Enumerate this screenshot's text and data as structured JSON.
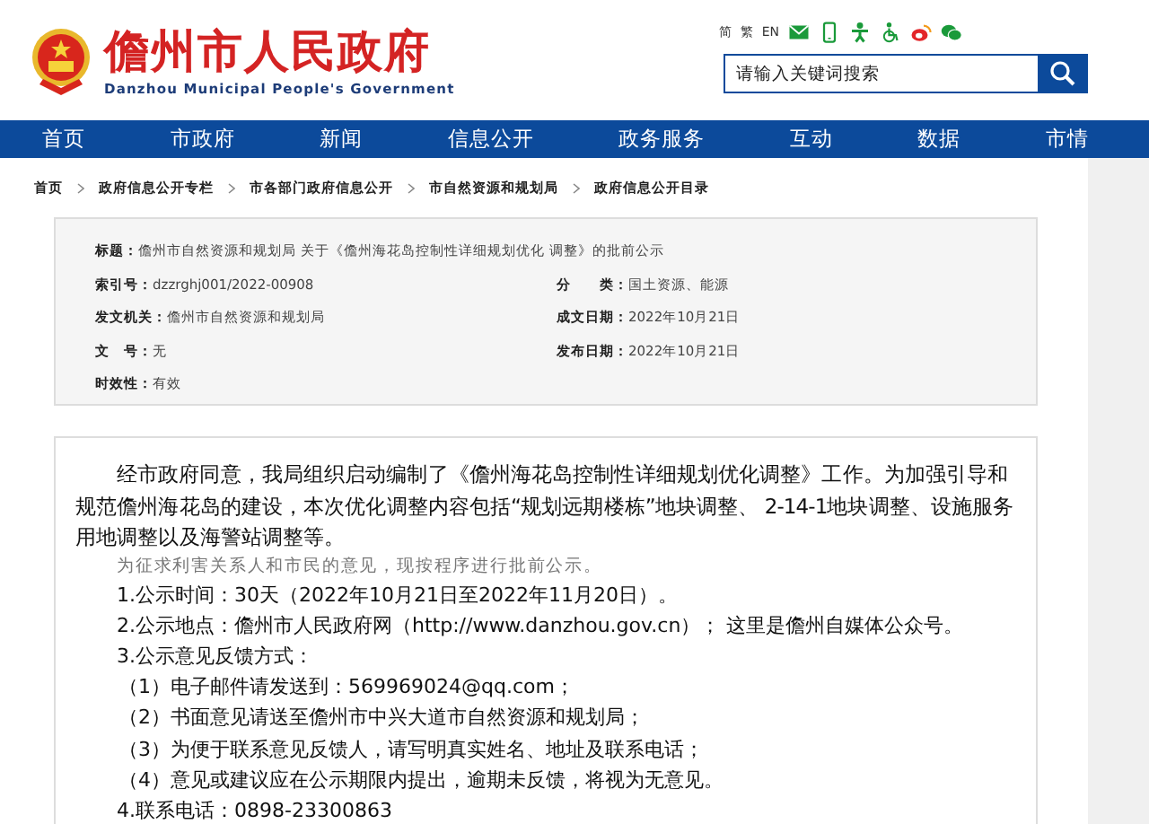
{
  "header": {
    "site_title": "儋州市人民政府",
    "site_subtitle": "Danzhou Municipal People's Government",
    "language_links": [
      "简",
      "繁",
      "EN"
    ],
    "search": {
      "placeholder": "请输入关键词搜索"
    }
  },
  "nav": [
    "首页",
    "市政府",
    "新闻",
    "信息公开",
    "政务服务",
    "互动",
    "数据",
    "市情"
  ],
  "breadcrumb": [
    "首页",
    "政府信息公开专栏",
    "市各部门政府信息公开",
    "市自然资源和规划局",
    "政府信息公开目录"
  ],
  "info": {
    "title": {
      "label": "标题：",
      "value": "儋州市自然资源和规划局 关于《儋州海花岛控制性详细规划优化 调整》的批前公示"
    },
    "rows": [
      [
        {
          "label": "索引号：",
          "value": "dzzrghj001/2022-00908"
        },
        {
          "label": "分　　类：",
          "value": "国土资源、能源"
        }
      ],
      [
        {
          "label": "发文机关：",
          "value": "儋州市自然资源和规划局"
        },
        {
          "label": "成文日期：",
          "value": "2022年10月21日"
        }
      ],
      [
        {
          "label": "文　号：",
          "value": "无"
        },
        {
          "label": "发布日期：",
          "value": "2022年10月21日"
        }
      ],
      [
        {
          "label": "时效性：",
          "value": "有效"
        }
      ]
    ]
  },
  "body": [
    {
      "kind": "para",
      "text": "经市政府同意，我局组织启动编制了《儋州海花岛控制性详细规划优化调整》工作。为加强引导和规范儋州海花岛的建设，本次优化调整内容包括“规划远期楼栋”地块调整、 2-14-1地块调整、设施服务用地调整以及海警站调整等。"
    },
    {
      "kind": "note",
      "text": "为征求利害关系人和市民的意见，现按程序进行批前公示。"
    },
    {
      "kind": "item",
      "text": "1.公示时间：30天（2022年10月21日至2022年11月20日）。"
    },
    {
      "kind": "item",
      "text": "2.公示地点：儋州市人民政府网（http://www.danzhou.gov.cn）； 这里是儋州自媒体公众号。"
    },
    {
      "kind": "item",
      "text": "3.公示意见反馈方式："
    },
    {
      "kind": "subitem",
      "text": "（1）电子邮件请发送到：569969024@qq.com；"
    },
    {
      "kind": "subitem",
      "text": "（2）书面意见请送至儋州市中兴大道市自然资源和规划局；"
    },
    {
      "kind": "subitem",
      "text": "（3）为便于联系意见反馈人，请写明真实姓名、地址及联系电话；"
    },
    {
      "kind": "subitem",
      "text": "（4）意见或建议应在公示期限内提出，逾期未反馈，将视为无意见。"
    },
    {
      "kind": "item",
      "text": "4.联系电话：0898-23300863"
    }
  ]
}
